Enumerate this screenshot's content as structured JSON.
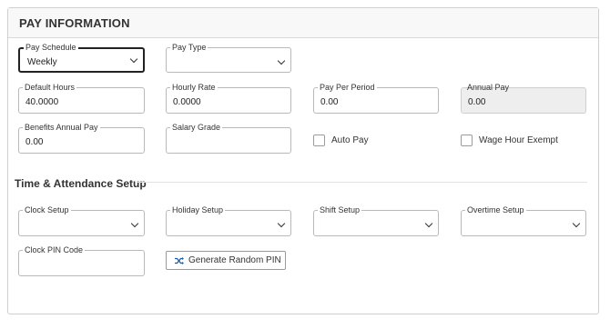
{
  "header": {
    "title": "PAY INFORMATION"
  },
  "pay": {
    "pay_schedule": {
      "label": "Pay Schedule",
      "value": "Weekly"
    },
    "pay_type": {
      "label": "Pay Type",
      "value": ""
    },
    "default_hours": {
      "label": "Default Hours",
      "value": "40.0000"
    },
    "hourly_rate": {
      "label": "Hourly Rate",
      "value": "0.0000"
    },
    "pay_per_period": {
      "label": "Pay Per Period",
      "value": "0.00"
    },
    "annual_pay": {
      "label": "Annual Pay",
      "value": "0.00"
    },
    "benefits_annual_pay": {
      "label": "Benefits Annual Pay",
      "value": "0.00"
    },
    "salary_grade": {
      "label": "Salary Grade",
      "value": ""
    },
    "auto_pay": {
      "label": "Auto Pay",
      "checked": false
    },
    "wage_hour_exempt": {
      "label": "Wage Hour Exempt",
      "checked": false
    }
  },
  "time_attendance": {
    "title": "Time & Attendance Setup",
    "clock_setup": {
      "label": "Clock Setup",
      "value": ""
    },
    "holiday_setup": {
      "label": "Holiday Setup",
      "value": ""
    },
    "shift_setup": {
      "label": "Shift Setup",
      "value": ""
    },
    "overtime_setup": {
      "label": "Overtime Setup",
      "value": ""
    },
    "clock_pin_code": {
      "label": "Clock PIN Code",
      "value": ""
    },
    "generate_button": {
      "label": "Generate Random PIN",
      "icon": "shuffle-icon"
    }
  },
  "colors": {
    "accent": "#1a5dab",
    "border": "#b9b9b9",
    "disabled_bg": "#eeeeee"
  }
}
